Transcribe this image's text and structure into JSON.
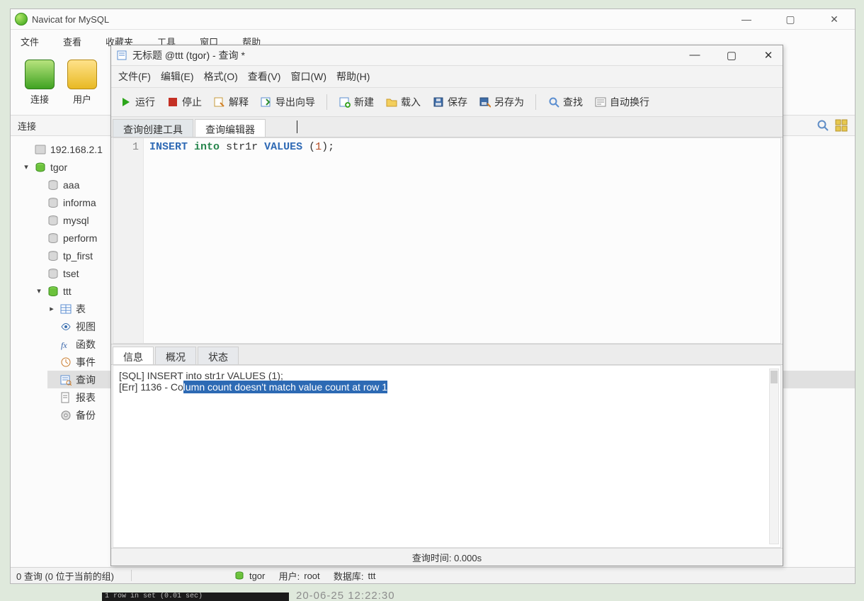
{
  "app": {
    "title": "Navicat for MySQL",
    "menu": [
      "文件",
      "查看",
      "收藏夹",
      "工具",
      "窗口",
      "帮助"
    ],
    "toolbar": {
      "connection": "连接",
      "user": "用户"
    },
    "panel_label": "连接"
  },
  "tree": {
    "host": "192.168.2.1",
    "server": "tgor",
    "dbs": [
      "aaa",
      "informa",
      "mysql",
      "perform",
      "tp_first",
      "tset"
    ],
    "activeDb": "ttt",
    "nodes": {
      "tables": "表",
      "views": "视图",
      "functions": "函数",
      "events": "事件",
      "queries": "查询",
      "reports": "报表",
      "backups": "备份"
    }
  },
  "child": {
    "title": "无标题 @ttt (tgor) - 查询 *",
    "menu": {
      "file": "文件(F)",
      "edit": "编辑(E)",
      "format": "格式(O)",
      "view": "查看(V)",
      "window": "窗口(W)",
      "help": "帮助(H)"
    },
    "toolbar": {
      "run": "运行",
      "stop": "停止",
      "explain": "解释",
      "export": "导出向导",
      "new": "新建",
      "load": "载入",
      "save": "保存",
      "saveas": "另存为",
      "find": "查找",
      "wrap": "自动换行"
    },
    "tabs": {
      "builder": "查询创建工具",
      "editor": "查询编辑器"
    },
    "editor": {
      "line_no": "1",
      "kw_insert": "INSERT",
      "kw_into": "into",
      "ident": "str1r",
      "kw_values": "VALUES",
      "paren_open": "(",
      "num": "1",
      "paren_close": ");"
    },
    "result_tabs": {
      "info": "信息",
      "summary": "概况",
      "status": "状态"
    },
    "result": {
      "sql_line": "[SQL] INSERT into str1r VALUES (1);",
      "err_prefix": "[Err] 1136 - Co",
      "err_selected": "lumn count doesn't match value count at row 1"
    },
    "status": "查询时间: 0.000s"
  },
  "status": {
    "left": "0 查询 (0 位于当前的组)",
    "server": "tgor",
    "user_label": "用户:",
    "user": "root",
    "db_label": "数据库:",
    "db": "ttt"
  },
  "desk": {
    "timestamp": "20-06-25 12:22:30"
  }
}
